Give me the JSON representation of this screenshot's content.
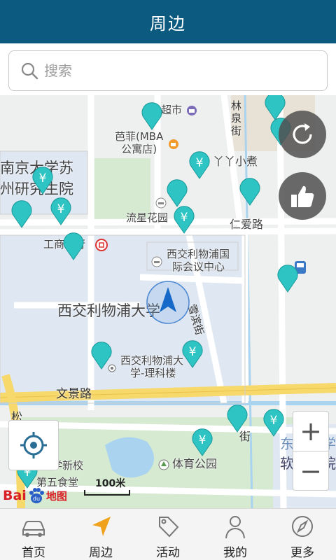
{
  "header": {
    "title": "周边"
  },
  "search": {
    "placeholder": "搜索"
  },
  "map": {
    "labels": {
      "supermarket": "超市",
      "bafei_line1": "芭菲(MBA",
      "bafei_line2": "公寓店)",
      "nju_line1": "南京大学苏",
      "nju_line2": "州研究生院",
      "yaya": "丫丫小煮",
      "liuxing": "流星花园",
      "renai_road": "仁爱路",
      "icbc": "工商银行",
      "xjtlu_conf_line1": "西交利物浦国",
      "xjtlu_conf_line2": "际会议中心",
      "xjtlu": "西交利物浦大学",
      "xueqiao_street": "雪滨街",
      "xjtlu_sci_line1": "西交利物浦大",
      "xjtlu_sci_line2": "学-理科楼",
      "wenjing_road": "文景路",
      "song_street": "松",
      "linquan_street": "林泉街",
      "jie": "街",
      "tiyu_park": "体育公园",
      "new_campus": "学新校",
      "fifth_canteen": "第五食堂",
      "dongnan_line1": "东南大学",
      "dongnan_line2": "软件学院"
    },
    "scale": "100米",
    "baidu": {
      "text": "Bai",
      "du": "du",
      "map": "地图"
    },
    "zoom_in": "+",
    "zoom_out": "−"
  },
  "colors": {
    "header_bg": "#0c5a80",
    "pin": "#2ec4c4",
    "location_arrow": "#1769c9"
  },
  "tabs": [
    {
      "label": "首页",
      "icon": "car-icon"
    },
    {
      "label": "周边",
      "icon": "navigation-arrow-icon",
      "active": true
    },
    {
      "label": "活动",
      "icon": "tag-icon"
    },
    {
      "label": "我的",
      "icon": "person-icon"
    },
    {
      "label": "更多",
      "icon": "compass-icon"
    }
  ]
}
